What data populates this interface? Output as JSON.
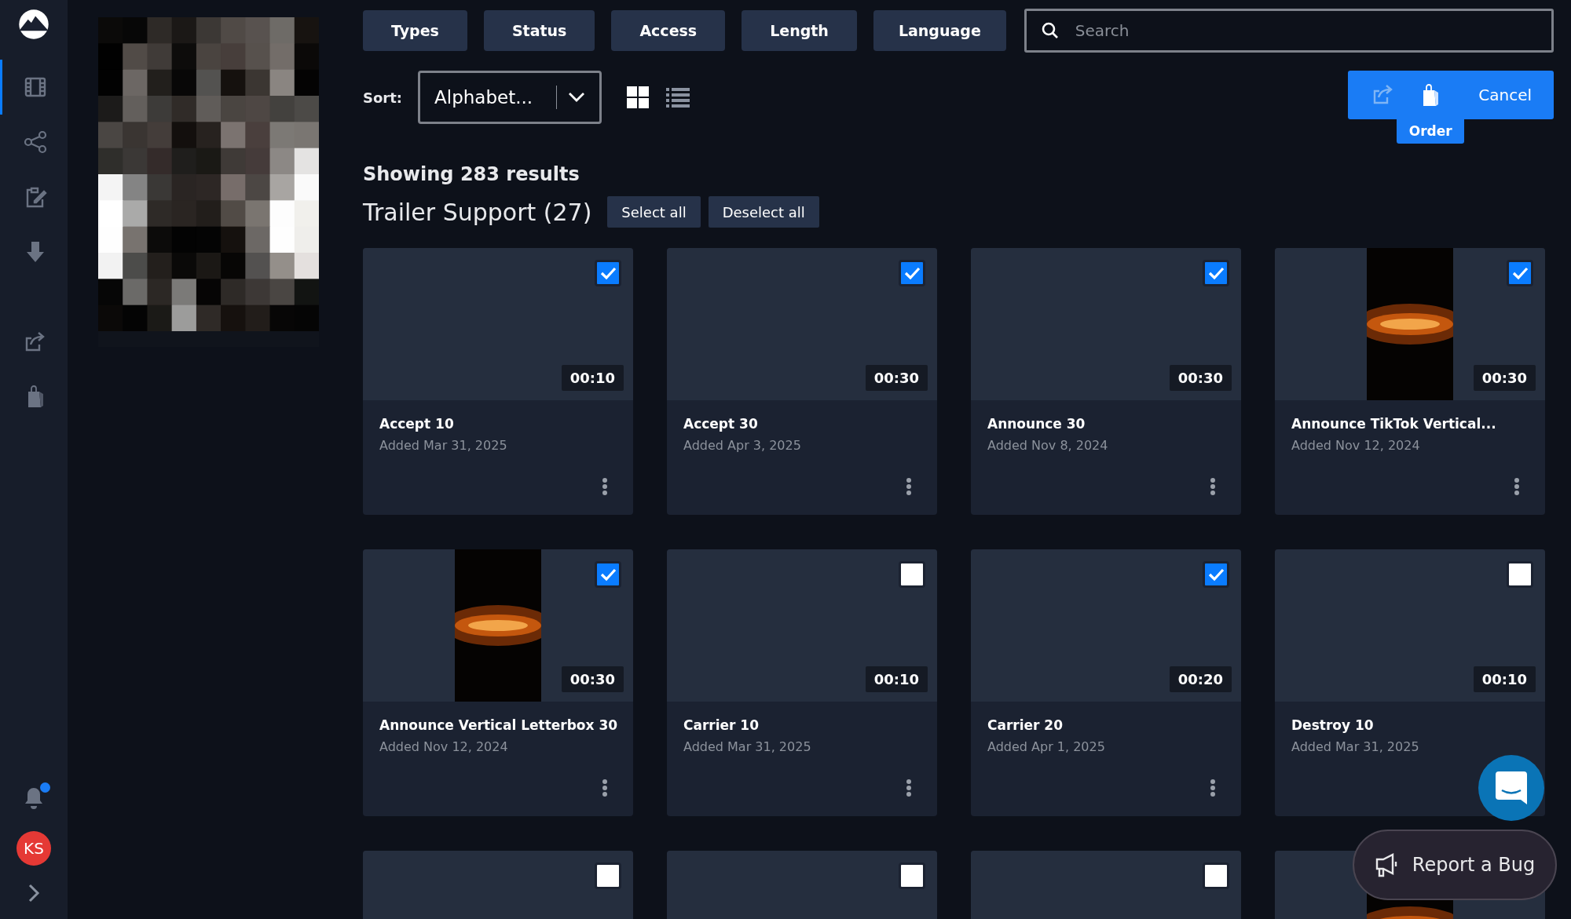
{
  "sidebar": {
    "items": [
      {
        "selected": true
      },
      {
        "selected": false
      },
      {
        "selected": false
      },
      {
        "selected": false
      },
      {
        "selected": false
      },
      {
        "selected": false
      }
    ],
    "notifications": {
      "unread": true
    },
    "avatar": "KS"
  },
  "filters": [
    "Types",
    "Status",
    "Access",
    "Length",
    "Language"
  ],
  "search": {
    "placeholder": "Search"
  },
  "sort": {
    "label": "Sort:",
    "value": "Alphabet..."
  },
  "views": [
    {
      "selected": true
    },
    {
      "selected": false
    }
  ],
  "actions": {
    "cancel": "Cancel",
    "tooltip": "Order"
  },
  "results": "Showing 283 results",
  "group": {
    "title": "Trailer Support (27)",
    "select_all": "Select all",
    "deselect_all": "Deselect all"
  },
  "cards": [
    {
      "kind": "plain",
      "checked": true,
      "duration": "00:10",
      "title": "Accept 10",
      "date": "Added Mar 31, 2025",
      "more_options": true
    },
    {
      "kind": "plain",
      "checked": true,
      "duration": "00:30",
      "title": "Accept 30",
      "date": "Added Apr 3, 2025",
      "more_options": true
    },
    {
      "kind": "plain",
      "checked": true,
      "duration": "00:30",
      "title": "Announce 30",
      "date": "Added Nov 8, 2024",
      "more_options": true
    },
    {
      "kind": "picture",
      "checked": true,
      "duration": "00:30",
      "title": "Announce TikTok Vertical...",
      "date": "Added Nov 12, 2024",
      "more_options": true
    },
    {
      "kind": "picture",
      "checked": true,
      "duration": "00:30",
      "title": "Announce Vertical Letterbox 30",
      "date": "Added Nov 12, 2024",
      "more_options": true
    },
    {
      "kind": "plain",
      "checked": false,
      "duration": "00:10",
      "title": "Carrier 10",
      "date": "Added Mar 31, 2025",
      "more_options": true
    },
    {
      "kind": "plain",
      "checked": true,
      "duration": "00:20",
      "title": "Carrier 20",
      "date": "Added Apr 1, 2025",
      "more_options": true
    },
    {
      "kind": "plain",
      "checked": false,
      "duration": "00:10",
      "title": "Destroy 10",
      "date": "Added Mar 31, 2025",
      "more_options": false
    },
    {
      "kind": "plain",
      "checked": false
    },
    {
      "kind": "plain",
      "checked": false
    },
    {
      "kind": "plain",
      "checked": false
    },
    {
      "kind": "picture"
    }
  ],
  "report_bug": "Report a Bug"
}
